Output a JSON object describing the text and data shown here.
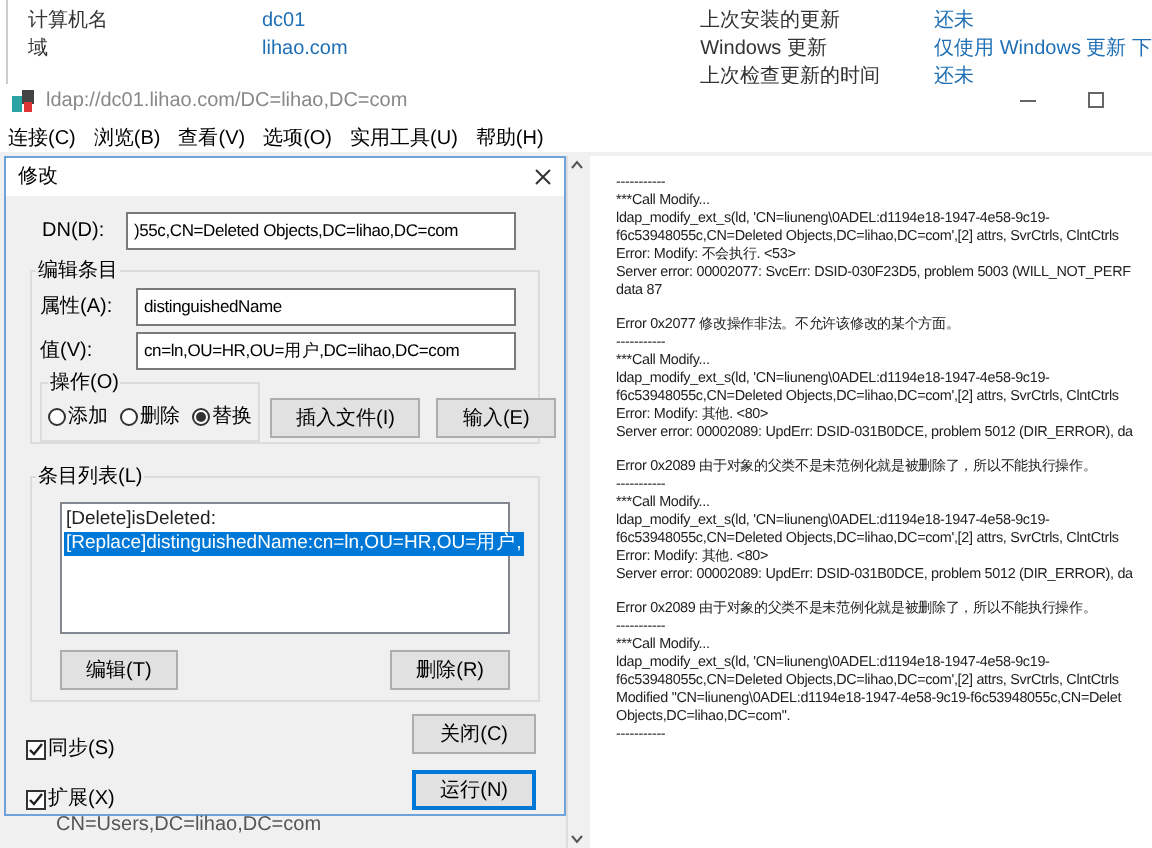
{
  "server_info": {
    "left": [
      {
        "label": "计算机名",
        "value": "dc01"
      },
      {
        "label": "域",
        "value": "lihao.com"
      }
    ],
    "right": [
      {
        "label": "上次安装的更新",
        "value": "还未"
      },
      {
        "label": "Windows 更新",
        "value": "仅使用 Windows 更新 下"
      },
      {
        "label": "上次检查更新的时间",
        "value": "还未"
      }
    ]
  },
  "window": {
    "title": "ldap://dc01.lihao.com/DC=lihao,DC=com"
  },
  "menu": [
    "连接(C)",
    "浏览(B)",
    "查看(V)",
    "选项(O)",
    "实用工具(U)",
    "帮助(H)"
  ],
  "dialog": {
    "title": "修改",
    "dn_label": "DN(D):",
    "dn_value": ")55c,CN=Deleted Objects,DC=lihao,DC=com",
    "edit_group": "编辑条目",
    "attr_label": "属性(A):",
    "attr_value": "distinguishedName",
    "value_label": "值(V):",
    "value_value": "cn=ln,OU=HR,OU=用户,DC=lihao,DC=com",
    "op_group": "操作(O)",
    "operations": [
      {
        "label": "添加",
        "selected": false
      },
      {
        "label": "删除",
        "selected": false
      },
      {
        "label": "替换",
        "selected": true
      }
    ],
    "insert_file": "插入文件(I)",
    "enter": "输入(E)",
    "list_group": "条目列表(L)",
    "entries": [
      {
        "text": "[Delete]isDeleted:",
        "selected": false
      },
      {
        "text": "[Replace]distinguishedName:cn=ln,OU=HR,OU=用户,",
        "selected": true
      }
    ],
    "edit_button": "编辑(T)",
    "delete_button": "删除(R)",
    "options": [
      {
        "label": "同步(S)",
        "checked": true
      },
      {
        "label": "扩展(X)",
        "checked": true
      }
    ],
    "close_button": "关闭(C)",
    "run_button": "运行(N)"
  },
  "tree_item": "CN=Users,DC=lihao,DC=com",
  "log": [
    [
      "-----------",
      "***Call Modify...",
      "ldap_modify_ext_s(ld, 'CN=liuneng\\0ADEL:d1194e18-1947-4e58-9c19-",
      "f6c53948055c,CN=Deleted Objects,DC=lihao,DC=com',[2] attrs, SvrCtrls, ClntCtrls",
      "Error: Modify: 不会执行. <53>",
      "Server error: 00002077: SvcErr: DSID-030F23D5, problem 5003 (WILL_NOT_PERF",
      "data 87"
    ],
    [
      "Error 0x2077 修改操作非法。不允许该修改的某个方面。",
      "-----------",
      "***Call Modify...",
      "ldap_modify_ext_s(ld, 'CN=liuneng\\0ADEL:d1194e18-1947-4e58-9c19-",
      "f6c53948055c,CN=Deleted Objects,DC=lihao,DC=com',[2] attrs, SvrCtrls, ClntCtrls",
      "Error: Modify: 其他. <80>",
      "Server error: 00002089: UpdErr: DSID-031B0DCE, problem 5012 (DIR_ERROR), da"
    ],
    [
      "Error 0x2089 由于对象的父类不是未范例化就是被删除了，所以不能执行操作。",
      "-----------",
      "***Call Modify...",
      "ldap_modify_ext_s(ld, 'CN=liuneng\\0ADEL:d1194e18-1947-4e58-9c19-",
      "f6c53948055c,CN=Deleted Objects,DC=lihao,DC=com',[2] attrs, SvrCtrls, ClntCtrls",
      "Error: Modify: 其他. <80>",
      "Server error: 00002089: UpdErr: DSID-031B0DCE, problem 5012 (DIR_ERROR), da"
    ],
    [
      "Error 0x2089 由于对象的父类不是未范例化就是被删除了，所以不能执行操作。",
      "-----------",
      "***Call Modify...",
      "ldap_modify_ext_s(ld, 'CN=liuneng\\0ADEL:d1194e18-1947-4e58-9c19-",
      "f6c53948055c,CN=Deleted Objects,DC=lihao,DC=com',[2] attrs, SvrCtrls, ClntCtrls",
      "Modified \"CN=liuneng\\0ADEL:d1194e18-1947-4e58-9c19-f6c53948055c,CN=Delet",
      "Objects,DC=lihao,DC=com\".",
      "-----------"
    ]
  ]
}
